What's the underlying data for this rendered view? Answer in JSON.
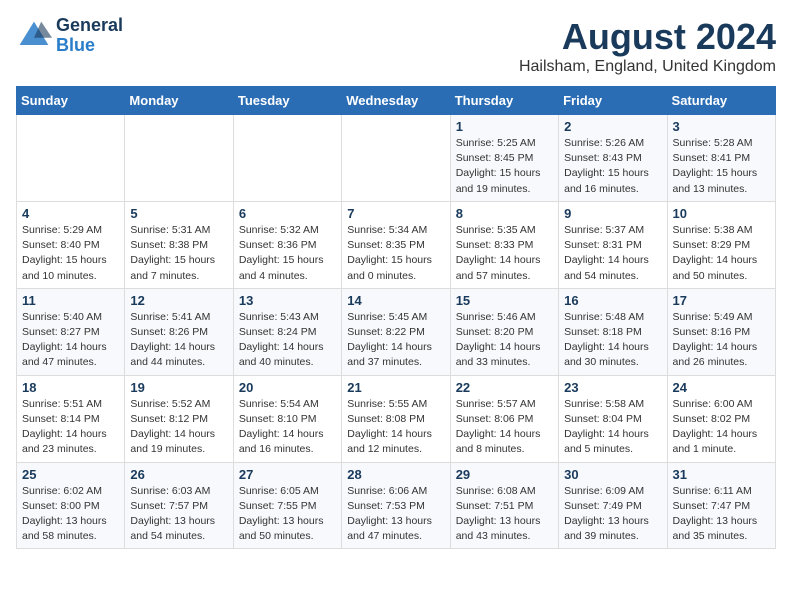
{
  "header": {
    "logo_general": "General",
    "logo_blue": "Blue",
    "title": "August 2024",
    "subtitle": "Hailsham, England, United Kingdom"
  },
  "columns": [
    "Sunday",
    "Monday",
    "Tuesday",
    "Wednesday",
    "Thursday",
    "Friday",
    "Saturday"
  ],
  "weeks": [
    [
      {
        "day": "",
        "info": ""
      },
      {
        "day": "",
        "info": ""
      },
      {
        "day": "",
        "info": ""
      },
      {
        "day": "",
        "info": ""
      },
      {
        "day": "1",
        "info": "Sunrise: 5:25 AM\nSunset: 8:45 PM\nDaylight: 15 hours\nand 19 minutes."
      },
      {
        "day": "2",
        "info": "Sunrise: 5:26 AM\nSunset: 8:43 PM\nDaylight: 15 hours\nand 16 minutes."
      },
      {
        "day": "3",
        "info": "Sunrise: 5:28 AM\nSunset: 8:41 PM\nDaylight: 15 hours\nand 13 minutes."
      }
    ],
    [
      {
        "day": "4",
        "info": "Sunrise: 5:29 AM\nSunset: 8:40 PM\nDaylight: 15 hours\nand 10 minutes."
      },
      {
        "day": "5",
        "info": "Sunrise: 5:31 AM\nSunset: 8:38 PM\nDaylight: 15 hours\nand 7 minutes."
      },
      {
        "day": "6",
        "info": "Sunrise: 5:32 AM\nSunset: 8:36 PM\nDaylight: 15 hours\nand 4 minutes."
      },
      {
        "day": "7",
        "info": "Sunrise: 5:34 AM\nSunset: 8:35 PM\nDaylight: 15 hours\nand 0 minutes."
      },
      {
        "day": "8",
        "info": "Sunrise: 5:35 AM\nSunset: 8:33 PM\nDaylight: 14 hours\nand 57 minutes."
      },
      {
        "day": "9",
        "info": "Sunrise: 5:37 AM\nSunset: 8:31 PM\nDaylight: 14 hours\nand 54 minutes."
      },
      {
        "day": "10",
        "info": "Sunrise: 5:38 AM\nSunset: 8:29 PM\nDaylight: 14 hours\nand 50 minutes."
      }
    ],
    [
      {
        "day": "11",
        "info": "Sunrise: 5:40 AM\nSunset: 8:27 PM\nDaylight: 14 hours\nand 47 minutes."
      },
      {
        "day": "12",
        "info": "Sunrise: 5:41 AM\nSunset: 8:26 PM\nDaylight: 14 hours\nand 44 minutes."
      },
      {
        "day": "13",
        "info": "Sunrise: 5:43 AM\nSunset: 8:24 PM\nDaylight: 14 hours\nand 40 minutes."
      },
      {
        "day": "14",
        "info": "Sunrise: 5:45 AM\nSunset: 8:22 PM\nDaylight: 14 hours\nand 37 minutes."
      },
      {
        "day": "15",
        "info": "Sunrise: 5:46 AM\nSunset: 8:20 PM\nDaylight: 14 hours\nand 33 minutes."
      },
      {
        "day": "16",
        "info": "Sunrise: 5:48 AM\nSunset: 8:18 PM\nDaylight: 14 hours\nand 30 minutes."
      },
      {
        "day": "17",
        "info": "Sunrise: 5:49 AM\nSunset: 8:16 PM\nDaylight: 14 hours\nand 26 minutes."
      }
    ],
    [
      {
        "day": "18",
        "info": "Sunrise: 5:51 AM\nSunset: 8:14 PM\nDaylight: 14 hours\nand 23 minutes."
      },
      {
        "day": "19",
        "info": "Sunrise: 5:52 AM\nSunset: 8:12 PM\nDaylight: 14 hours\nand 19 minutes."
      },
      {
        "day": "20",
        "info": "Sunrise: 5:54 AM\nSunset: 8:10 PM\nDaylight: 14 hours\nand 16 minutes."
      },
      {
        "day": "21",
        "info": "Sunrise: 5:55 AM\nSunset: 8:08 PM\nDaylight: 14 hours\nand 12 minutes."
      },
      {
        "day": "22",
        "info": "Sunrise: 5:57 AM\nSunset: 8:06 PM\nDaylight: 14 hours\nand 8 minutes."
      },
      {
        "day": "23",
        "info": "Sunrise: 5:58 AM\nSunset: 8:04 PM\nDaylight: 14 hours\nand 5 minutes."
      },
      {
        "day": "24",
        "info": "Sunrise: 6:00 AM\nSunset: 8:02 PM\nDaylight: 14 hours\nand 1 minute."
      }
    ],
    [
      {
        "day": "25",
        "info": "Sunrise: 6:02 AM\nSunset: 8:00 PM\nDaylight: 13 hours\nand 58 minutes."
      },
      {
        "day": "26",
        "info": "Sunrise: 6:03 AM\nSunset: 7:57 PM\nDaylight: 13 hours\nand 54 minutes."
      },
      {
        "day": "27",
        "info": "Sunrise: 6:05 AM\nSunset: 7:55 PM\nDaylight: 13 hours\nand 50 minutes."
      },
      {
        "day": "28",
        "info": "Sunrise: 6:06 AM\nSunset: 7:53 PM\nDaylight: 13 hours\nand 47 minutes."
      },
      {
        "day": "29",
        "info": "Sunrise: 6:08 AM\nSunset: 7:51 PM\nDaylight: 13 hours\nand 43 minutes."
      },
      {
        "day": "30",
        "info": "Sunrise: 6:09 AM\nSunset: 7:49 PM\nDaylight: 13 hours\nand 39 minutes."
      },
      {
        "day": "31",
        "info": "Sunrise: 6:11 AM\nSunset: 7:47 PM\nDaylight: 13 hours\nand 35 minutes."
      }
    ]
  ]
}
